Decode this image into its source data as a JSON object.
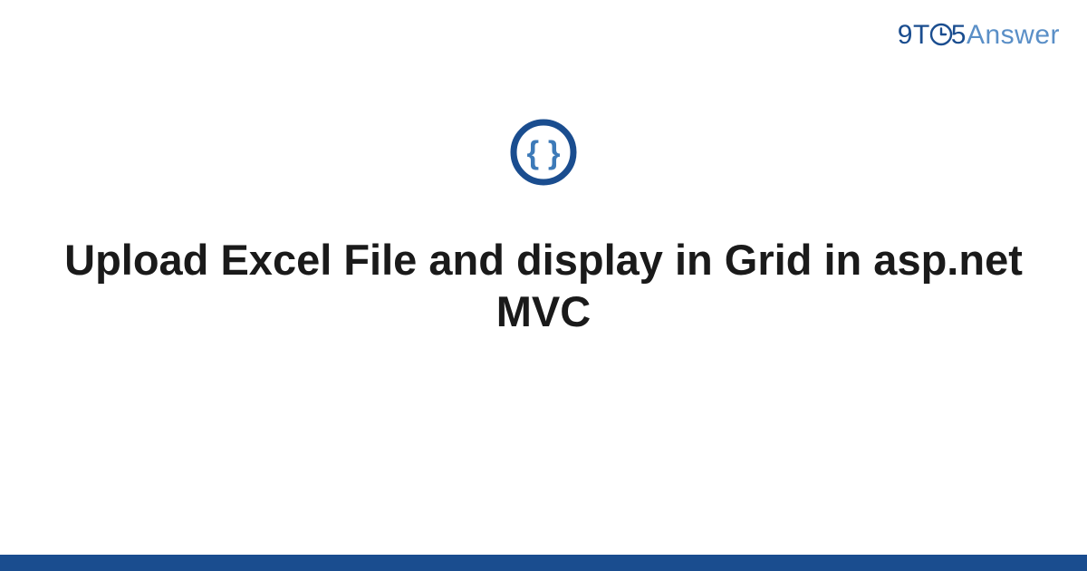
{
  "brand": {
    "part1": "9",
    "part2": "T",
    "part3": "5",
    "part4": "Answer"
  },
  "icon": {
    "name": "code-braces-icon"
  },
  "title": "Upload Excel File and display in Grid in asp.net MVC",
  "colors": {
    "primary": "#1a4d8f",
    "secondary": "#5a8fc7",
    "accent": "#3d7ab8"
  }
}
